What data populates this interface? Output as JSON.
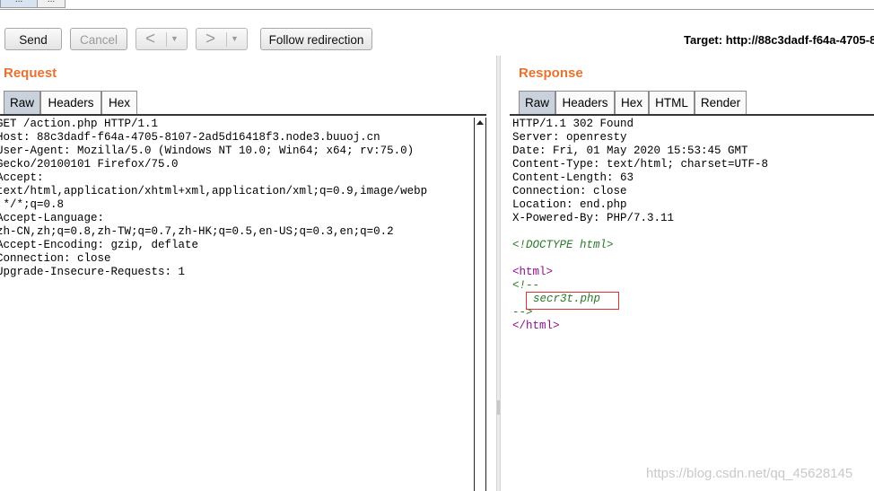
{
  "window": {
    "top_tabs": [
      "...",
      "..."
    ]
  },
  "toolbar": {
    "send_label": "Send",
    "cancel_label": "Cancel",
    "back_arrow": "<",
    "forward_arrow": ">",
    "dropdown_glyph": "▼",
    "follow_redirection_label": "Follow redirection",
    "target_label": "Target: http://88c3dadf-f64a-4705-8"
  },
  "request": {
    "title": "Request",
    "tabs": [
      "Raw",
      "Headers",
      "Hex"
    ],
    "lines": [
      "GET /action.php HTTP/1.1",
      "Host: 88c3dadf-f64a-4705-8107-2ad5d16418f3.node3.buuoj.cn",
      "User-Agent: Mozilla/5.0 (Windows NT 10.0; Win64; x64; rv:75.0)",
      "Gecko/20100101 Firefox/75.0",
      "Accept:",
      "text/html,application/xhtml+xml,application/xml;q=0.9,image/webp",
      ",*/*;q=0.8",
      "Accept-Language:",
      "zh-CN,zh;q=0.8,zh-TW;q=0.7,zh-HK;q=0.5,en-US;q=0.3,en;q=0.2",
      "Accept-Encoding: gzip, deflate",
      "Connection: close",
      "Upgrade-Insecure-Requests: 1"
    ]
  },
  "response": {
    "title": "Response",
    "tabs": [
      "Raw",
      "Headers",
      "Hex",
      "HTML",
      "Render"
    ],
    "header_lines": [
      "HTTP/1.1 302 Found",
      "Server: openresty",
      "Date: Fri, 01 May 2020 15:53:45 GMT",
      "Content-Type: text/html; charset=UTF-8",
      "Content-Length: 63",
      "Connection: close",
      "Location: end.php",
      "X-Powered-By: PHP/7.3.11"
    ],
    "doctype": "<!DOCTYPE html>",
    "html_open": "<html>",
    "comment_open": "<!--",
    "comment_body": "secr3t.php",
    "comment_close": "-->",
    "html_close": "</html>"
  },
  "watermark": "https://blog.csdn.net/qq_45628145",
  "colors": {
    "section_title": "#e8722f",
    "highlight_box": "#e03030"
  }
}
